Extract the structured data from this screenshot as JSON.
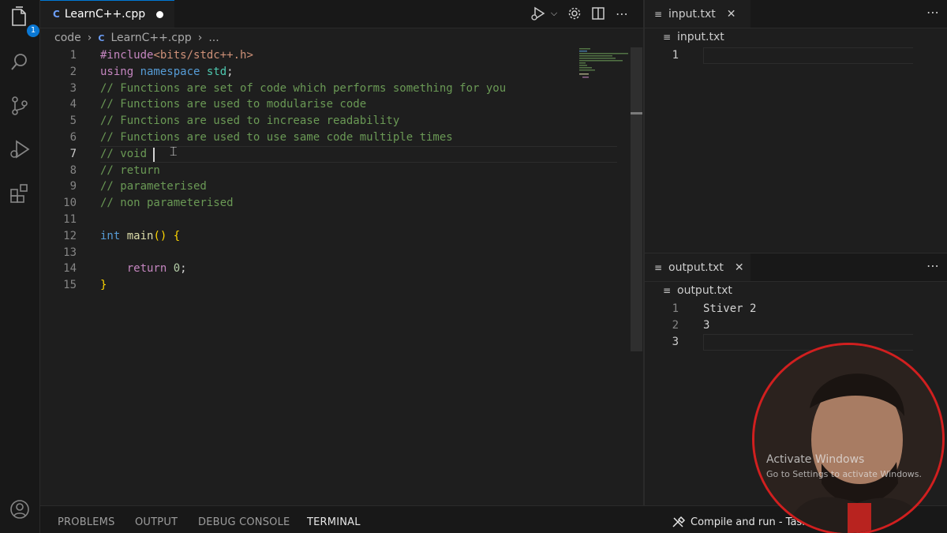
{
  "activity_bar": {
    "explorer_badge": "1",
    "items": [
      "explorer-icon",
      "search-icon",
      "source-control-icon",
      "run-debug-icon",
      "extensions-icon",
      "account-icon"
    ]
  },
  "editor_main": {
    "tab": {
      "label": "LearnC++.cpp",
      "icon": "c++-file-icon",
      "modified": true
    },
    "breadcrumb": {
      "folder": "code",
      "file": "LearnC++.cpp",
      "tail": "..."
    },
    "lines": [
      {
        "n": "1",
        "tokens": [
          [
            "pp",
            "#include"
          ],
          [
            "inc",
            "<bits/stdc++.h>"
          ]
        ]
      },
      {
        "n": "2",
        "tokens": [
          [
            "kw2",
            "using "
          ],
          [
            "kw",
            "namespace "
          ],
          [
            "ty",
            "std"
          ],
          [
            "pl",
            ";"
          ]
        ]
      },
      {
        "n": "3",
        "tokens": [
          [
            "cm",
            "// Functions are set of code which performs something for you"
          ]
        ]
      },
      {
        "n": "4",
        "tokens": [
          [
            "cm",
            "// Functions are used to modularise code"
          ]
        ]
      },
      {
        "n": "5",
        "tokens": [
          [
            "cm",
            "// Functions are used to increase readability"
          ]
        ]
      },
      {
        "n": "6",
        "tokens": [
          [
            "cm",
            "// Functions are used to use same code multiple times"
          ]
        ]
      },
      {
        "n": "7",
        "tokens": [
          [
            "cm",
            "// void "
          ]
        ],
        "current": true
      },
      {
        "n": "8",
        "tokens": [
          [
            "cm",
            "// return"
          ]
        ]
      },
      {
        "n": "9",
        "tokens": [
          [
            "cm",
            "// parameterised"
          ]
        ]
      },
      {
        "n": "10",
        "tokens": [
          [
            "cm",
            "// non parameterised"
          ]
        ]
      },
      {
        "n": "11",
        "tokens": []
      },
      {
        "n": "12",
        "tokens": [
          [
            "kw",
            "int "
          ],
          [
            "fn",
            "main"
          ],
          [
            "br",
            "() {"
          ]
        ]
      },
      {
        "n": "13",
        "tokens": []
      },
      {
        "n": "14",
        "tokens": [
          [
            "pl",
            "    "
          ],
          [
            "kw2",
            "return "
          ],
          [
            "num",
            "0"
          ],
          [
            "pl",
            ";"
          ]
        ]
      },
      {
        "n": "15",
        "tokens": [
          [
            "br",
            "}"
          ]
        ]
      }
    ]
  },
  "input_pane": {
    "tab_label": "input.txt",
    "crumb": "input.txt",
    "lines": [
      {
        "n": "1",
        "text": "",
        "current": true
      }
    ]
  },
  "output_pane": {
    "tab_label": "output.txt",
    "crumb": "output.txt",
    "lines": [
      {
        "n": "1",
        "text": "Stiver 2"
      },
      {
        "n": "2",
        "text": "3"
      },
      {
        "n": "3",
        "text": "",
        "current": true
      }
    ]
  },
  "panel": {
    "tabs": [
      "PROBLEMS",
      "OUTPUT",
      "DEBUG CONSOLE",
      "TERMINAL"
    ],
    "active_tab": "TERMINAL",
    "task_label": "Compile and run - Task"
  },
  "watermark": {
    "title": "Activate Windows",
    "subtitle": "Go to Settings to activate Windows."
  },
  "colors": {
    "accent": "#0078d4",
    "webcam_ring": "#d11f1f"
  }
}
